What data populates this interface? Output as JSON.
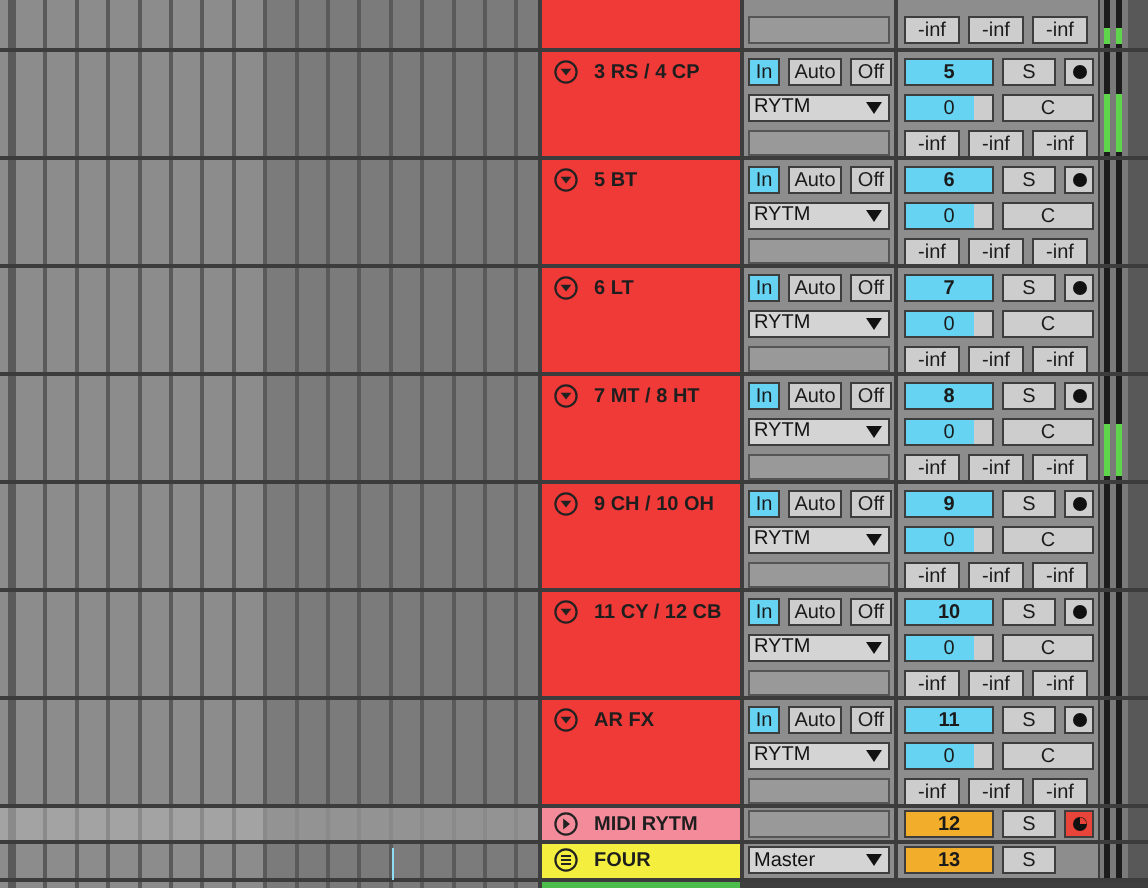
{
  "top_track": {
    "sends": [
      "-inf",
      "-inf",
      "-inf"
    ],
    "meter": {
      "level": 0.35
    }
  },
  "tracks": [
    {
      "kind": "audio",
      "name": "3 RS / 4 CP",
      "color": "#ef3a38",
      "expanded": true,
      "monitor": [
        {
          "label": "In",
          "selected": true
        },
        {
          "label": "Auto",
          "selected": false
        },
        {
          "label": "Off",
          "selected": false
        }
      ],
      "input": "RYTM",
      "number": "5",
      "solo": "S",
      "armed": false,
      "volume": {
        "value": "0",
        "level": 0.8
      },
      "pan": "C",
      "sends": [
        "-inf",
        "-inf",
        "-inf"
      ],
      "meter": {
        "level": 0.55
      }
    },
    {
      "kind": "audio",
      "name": "5 BT",
      "color": "#ef3a38",
      "expanded": true,
      "monitor": [
        {
          "label": "In",
          "selected": true
        },
        {
          "label": "Auto",
          "selected": false
        },
        {
          "label": "Off",
          "selected": false
        }
      ],
      "input": "RYTM",
      "number": "6",
      "solo": "S",
      "armed": false,
      "volume": {
        "value": "0",
        "level": 0.8
      },
      "pan": "C",
      "sends": [
        "-inf",
        "-inf",
        "-inf"
      ],
      "meter": {
        "level": 0
      }
    },
    {
      "kind": "audio",
      "name": "6 LT",
      "color": "#ef3a38",
      "expanded": true,
      "monitor": [
        {
          "label": "In",
          "selected": true
        },
        {
          "label": "Auto",
          "selected": false
        },
        {
          "label": "Off",
          "selected": false
        }
      ],
      "input": "RYTM",
      "number": "7",
      "solo": "S",
      "armed": false,
      "volume": {
        "value": "0",
        "level": 0.8
      },
      "pan": "C",
      "sends": [
        "-inf",
        "-inf",
        "-inf"
      ],
      "meter": {
        "level": 0
      }
    },
    {
      "kind": "audio",
      "name": "7 MT / 8 HT",
      "color": "#ef3a38",
      "expanded": true,
      "monitor": [
        {
          "label": "In",
          "selected": true
        },
        {
          "label": "Auto",
          "selected": false
        },
        {
          "label": "Off",
          "selected": false
        }
      ],
      "input": "RYTM",
      "number": "8",
      "solo": "S",
      "armed": false,
      "volume": {
        "value": "0",
        "level": 0.8
      },
      "pan": "C",
      "sends": [
        "-inf",
        "-inf",
        "-inf"
      ],
      "meter": {
        "level": 0.5
      }
    },
    {
      "kind": "audio",
      "name": "9 CH / 10 OH",
      "color": "#ef3a38",
      "expanded": true,
      "monitor": [
        {
          "label": "In",
          "selected": true
        },
        {
          "label": "Auto",
          "selected": false
        },
        {
          "label": "Off",
          "selected": false
        }
      ],
      "input": "RYTM",
      "number": "9",
      "solo": "S",
      "armed": false,
      "volume": {
        "value": "0",
        "level": 0.8
      },
      "pan": "C",
      "sends": [
        "-inf",
        "-inf",
        "-inf"
      ],
      "meter": {
        "level": 0
      }
    },
    {
      "kind": "audio",
      "name": "11 CY / 12 CB",
      "color": "#ef3a38",
      "expanded": true,
      "monitor": [
        {
          "label": "In",
          "selected": true
        },
        {
          "label": "Auto",
          "selected": false
        },
        {
          "label": "Off",
          "selected": false
        }
      ],
      "input": "RYTM",
      "number": "10",
      "solo": "S",
      "armed": false,
      "volume": {
        "value": "0",
        "level": 0.8
      },
      "pan": "C",
      "sends": [
        "-inf",
        "-inf",
        "-inf"
      ],
      "meter": {
        "level": 0
      }
    },
    {
      "kind": "audio",
      "name": "AR FX",
      "color": "#ef3a38",
      "expanded": true,
      "monitor": [
        {
          "label": "In",
          "selected": true
        },
        {
          "label": "Auto",
          "selected": false
        },
        {
          "label": "Off",
          "selected": false
        }
      ],
      "input": "RYTM",
      "number": "11",
      "solo": "S",
      "armed": false,
      "volume": {
        "value": "0",
        "level": 0.8
      },
      "pan": "C",
      "sends": [
        "-inf",
        "-inf",
        "-inf"
      ],
      "meter": {
        "level": 0
      }
    },
    {
      "kind": "group",
      "name": "MIDI RYTM",
      "color": "#f48b9b",
      "expanded": false,
      "number": "12",
      "solo": "S",
      "armed": true
    },
    {
      "kind": "return",
      "name": "FOUR",
      "color": "#f4ef3e",
      "output": "Master",
      "number": "13",
      "solo": "S"
    }
  ],
  "partial_track": {
    "color": "#4cbc4c"
  }
}
